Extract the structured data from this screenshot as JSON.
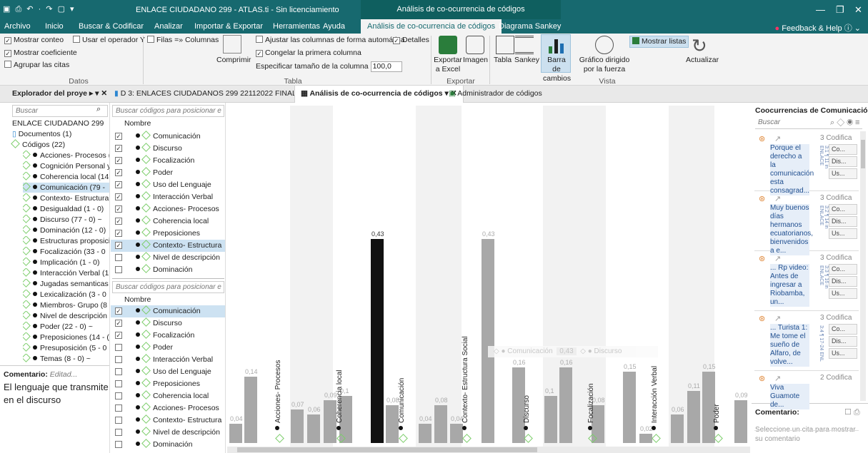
{
  "window": {
    "title": "ENLACE CIUDADANO 299 - ATLAS.ti - Sin licenciamiento",
    "context_tab": "Análisis de co-ocurrencia de códigos"
  },
  "menu": {
    "items": [
      "Archivo",
      "Inicio",
      "Buscar & Codificar",
      "Analizar",
      "Importar & Exportar",
      "Herramientas",
      "Ayuda",
      "Análisis de co-ocurrencia de códigos",
      "Diagrama Sankey"
    ],
    "help": "Feedback & Help"
  },
  "ribbon": {
    "datos": {
      "mostrar_conteo": "Mostrar conteo",
      "usar_operador": "Usar el operador Y",
      "mostrar_coef": "Mostrar coeficiente",
      "agrupar": "Agrupar las citas",
      "label": "Datos"
    },
    "tabla": {
      "filas": "Filas =» Columnas",
      "comprimir": "Comprimir",
      "ajustar": "Ajustar las columnas de forma automática",
      "detalles": "Detalles",
      "congelar": "Congelar la primera columna",
      "tamano": "Especificar tamaño de la columna",
      "tamano_val": "100,0",
      "label": "Tabla"
    },
    "exportar": {
      "excel": "Exportar a Excel",
      "imagen": "Imagen",
      "label": "Exportar"
    },
    "vista": {
      "tabla": "Tabla",
      "sankey": "Sankey",
      "barra": "Barra de cambios",
      "grafico": "Gráfico dirigido por la fuerza",
      "mostrar_listas": "Mostrar listas",
      "actualizar": "Actualizar",
      "label": "Vista"
    }
  },
  "doc_tabs": {
    "explorer": "Explorador del proye",
    "doc": "D 3: ENLACES CIUDADANOS 299 22112022 FINAL",
    "analysis": "Análisis de co-ocurrencia de códigos",
    "admin": "Administrador de códigos"
  },
  "explorer": {
    "search": "Buscar",
    "project": "ENLACE CIUDADANO 299",
    "documentos": "Documentos (1)",
    "codigos": "Códigos (22)",
    "codes": [
      "Acciones- Procesos (",
      "Cognición Personal y",
      "Coherencia local (14",
      "Comunicación (79 -",
      "Contexto- Estructura !",
      "Desigualdad (1 - 0)",
      "Discurso (77 - 0) ~",
      "Dominación (12 - 0)",
      "Estructuras proposicic",
      "Focalización (33 - 0",
      "Implicación (1 - 0)",
      "Interacción Verbal (1",
      "Jugadas semanticas lc",
      "Lexicalización (3 - 0",
      "Miembros- Grupo (8",
      "Nivel de descripción y",
      "Poder (22 - 0) ~",
      "Preposiciones (14 - (",
      "Presuposición (5 - 0",
      "Temas (8 - 0) ~"
    ],
    "comment_label": "Comentario:",
    "comment_edit": "Editad...",
    "comment": "El lenguaje que transmite en el discurso"
  },
  "list1": {
    "search": "Buscar códigos para posicionar e",
    "header": "Nombre",
    "items": [
      "Comunicación",
      "Discurso",
      "Focalización",
      "Poder",
      "Uso del Lenguaje",
      "Interacción Verbal",
      "Acciones- Procesos",
      "Coherencia local",
      "Preposiciones",
      "Contexto- Estructura",
      "Nivel de descripción",
      "Dominación"
    ]
  },
  "list2": {
    "search": "Buscar códigos para posicionar e",
    "header": "Nombre",
    "items": [
      "Comunicación",
      "Discurso",
      "Focalización",
      "Poder",
      "Interacción Verbal",
      "Uso del Lenguaje",
      "Preposiciones",
      "Coherencia local",
      "Acciones- Procesos",
      "Contexto- Estructura",
      "Nivel de descripción",
      "Dominación"
    ]
  },
  "chart_data": {
    "type": "bar",
    "groups": [
      "Acciones- Procesos",
      "Coherencia local",
      "Comunicación",
      "Contexto- Estructura Social",
      "Discurso",
      "Focalización",
      "Interacción Verbal",
      "Poder"
    ],
    "values": [
      0.04,
      0.14,
      0.07,
      0.06,
      0.09,
      0.1,
      0.43,
      0.08,
      0.04,
      0.08,
      0.04,
      0.43,
      0.16,
      0.1,
      0.16,
      0.08,
      0.15,
      0.02,
      0.06,
      0.11,
      0.15,
      0.09
    ],
    "labels": [
      "0,04",
      "0,14",
      "0,07",
      "0,06",
      "0,09",
      "0,1",
      "0,43",
      "0,08",
      "0,04",
      "0,08",
      "0,04",
      "0,43",
      "0,16",
      "0,1",
      "0,16",
      "0,08",
      "0,15",
      "0,02",
      "0,06",
      "0,11",
      "0,15",
      "0,09"
    ],
    "tooltip": {
      "a": "Comunicación",
      "value": "0,43",
      "b": "Discurso"
    }
  },
  "right": {
    "title": "Coocurrencias de Comunicación y Di",
    "search": "Buscar",
    "cards": [
      {
        "count": "3 Codifica",
        "quote": "Porque el derecho a la comunicación esta consagrad...",
        "id": "3:1 ¶ 11 in ENLACE"
      },
      {
        "count": "3 Codifica",
        "quote": "Muy buenos días hermanos ecuatorianos, bienvenidos a e...",
        "id": "3:2 ¶ 14 in ENLACE"
      },
      {
        "count": "3 Codifica",
        "quote": "... Rp video: Antes de ingresar a Riobamba, un...",
        "id": "3:3 ¶ 16 in ENLACE"
      },
      {
        "count": "3 Codifica",
        "quote": "... Turista 1: Me tome el sueño de Alfaro, de volve...",
        "id": "3:4 ¶ 17-24 ENL"
      },
      {
        "count": "2 Codifica",
        "quote": "Viva Guamote de...",
        "id": ""
      }
    ],
    "tags": [
      "Co...",
      "Dis...",
      "Us..."
    ],
    "comment_label": "Comentario:",
    "comment": "Seleccione un cita para mostrar su comentario"
  }
}
